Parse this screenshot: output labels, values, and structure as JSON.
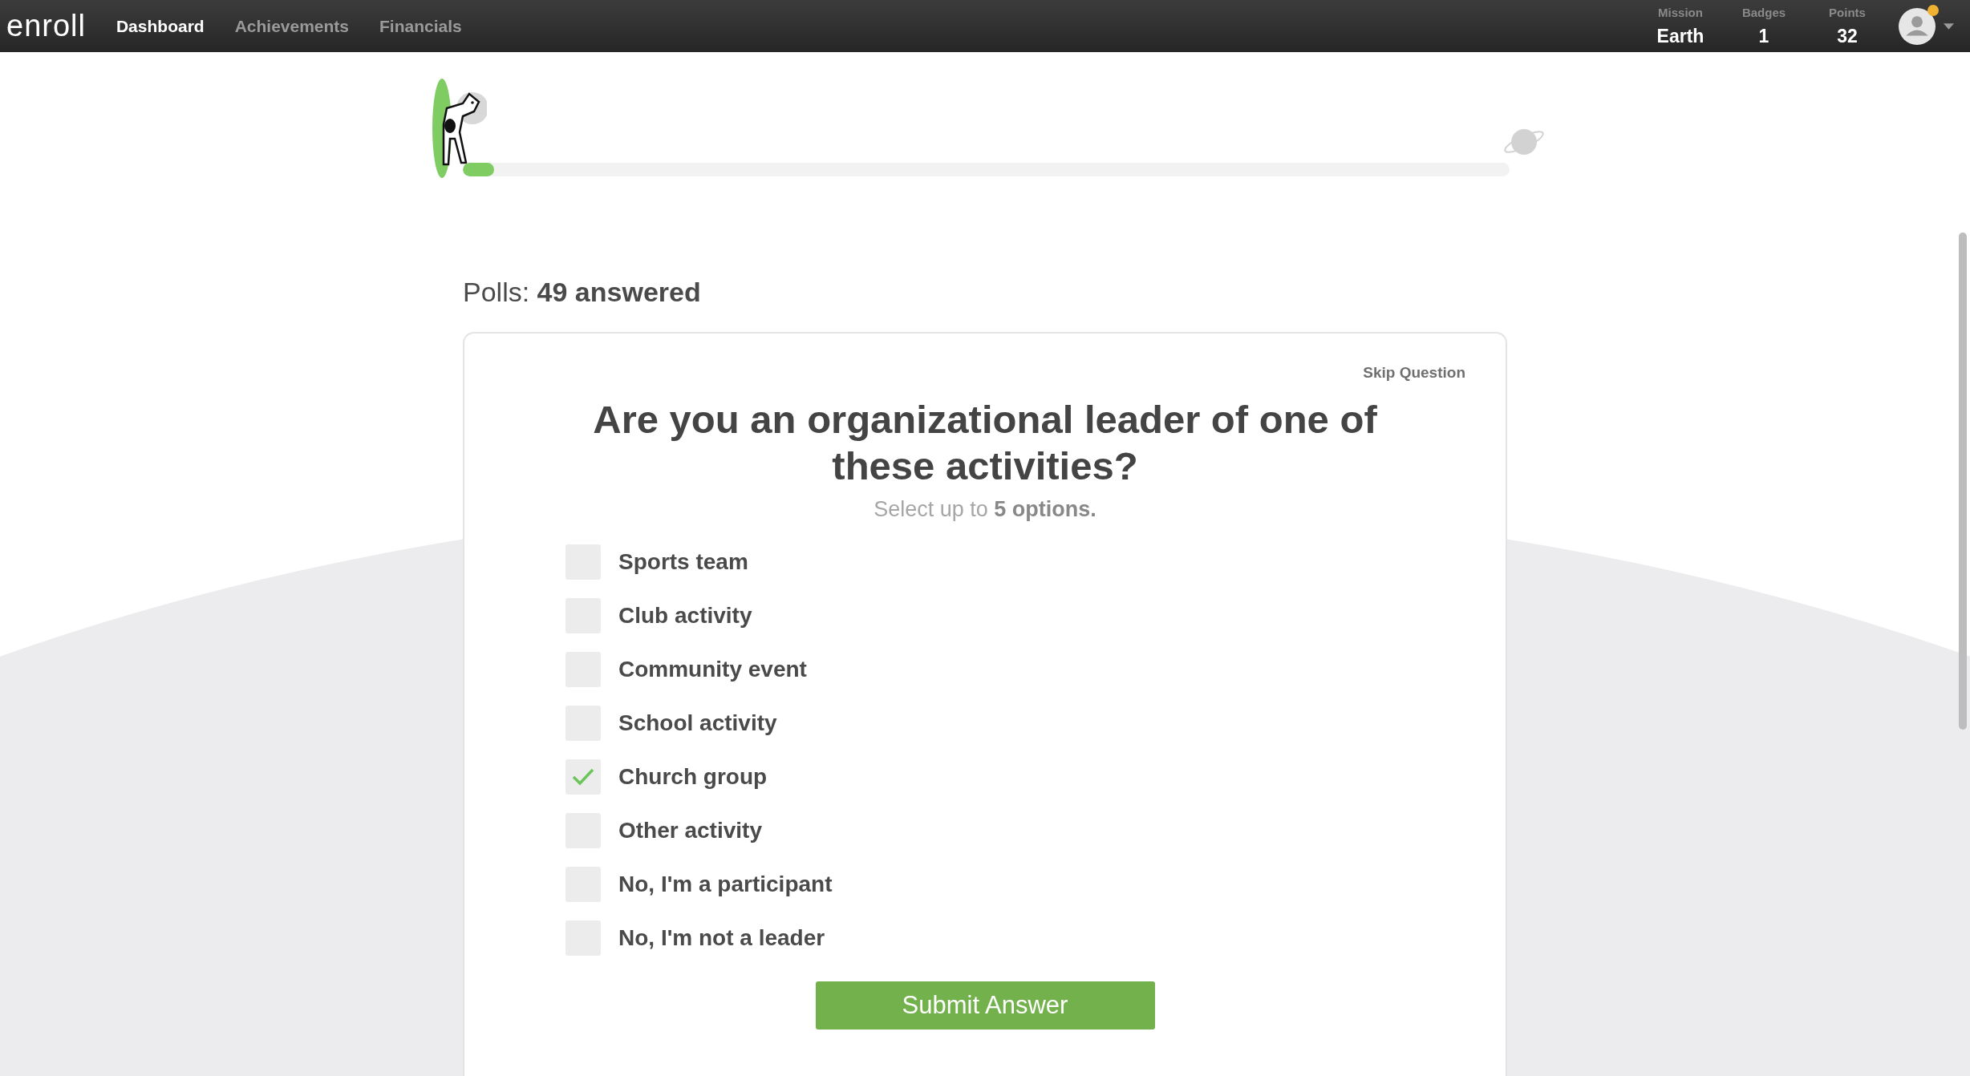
{
  "nav": {
    "logo": "enroll",
    "items": [
      {
        "label": "Dashboard",
        "selected": true
      },
      {
        "label": "Achievements",
        "selected": false
      },
      {
        "label": "Financials",
        "selected": false
      }
    ],
    "stats": [
      {
        "label": "Mission",
        "value": "Earth"
      },
      {
        "label": "Badges",
        "value": "1"
      },
      {
        "label": "Points",
        "value": "32"
      }
    ],
    "notification": true
  },
  "progress": {
    "level": 0.03
  },
  "polls": {
    "label": "Polls:",
    "count": "49 answered"
  },
  "question": {
    "skip": "Skip Question",
    "title": "Are you an organizational leader of one of these activities?",
    "subtitle": "Select up to **5 options.**",
    "options": [
      {
        "label": "Sports team",
        "checked": false
      },
      {
        "label": "Club activity",
        "checked": false
      },
      {
        "label": "Community event",
        "checked": false
      },
      {
        "label": "School activity",
        "checked": false
      },
      {
        "label": "Church group",
        "checked": true
      },
      {
        "label": "Other activity",
        "checked": false
      },
      {
        "label": "No, I'm a participant",
        "checked": false
      },
      {
        "label": "No, I'm not a leader",
        "checked": false
      }
    ],
    "submit": "Submit Answer"
  }
}
